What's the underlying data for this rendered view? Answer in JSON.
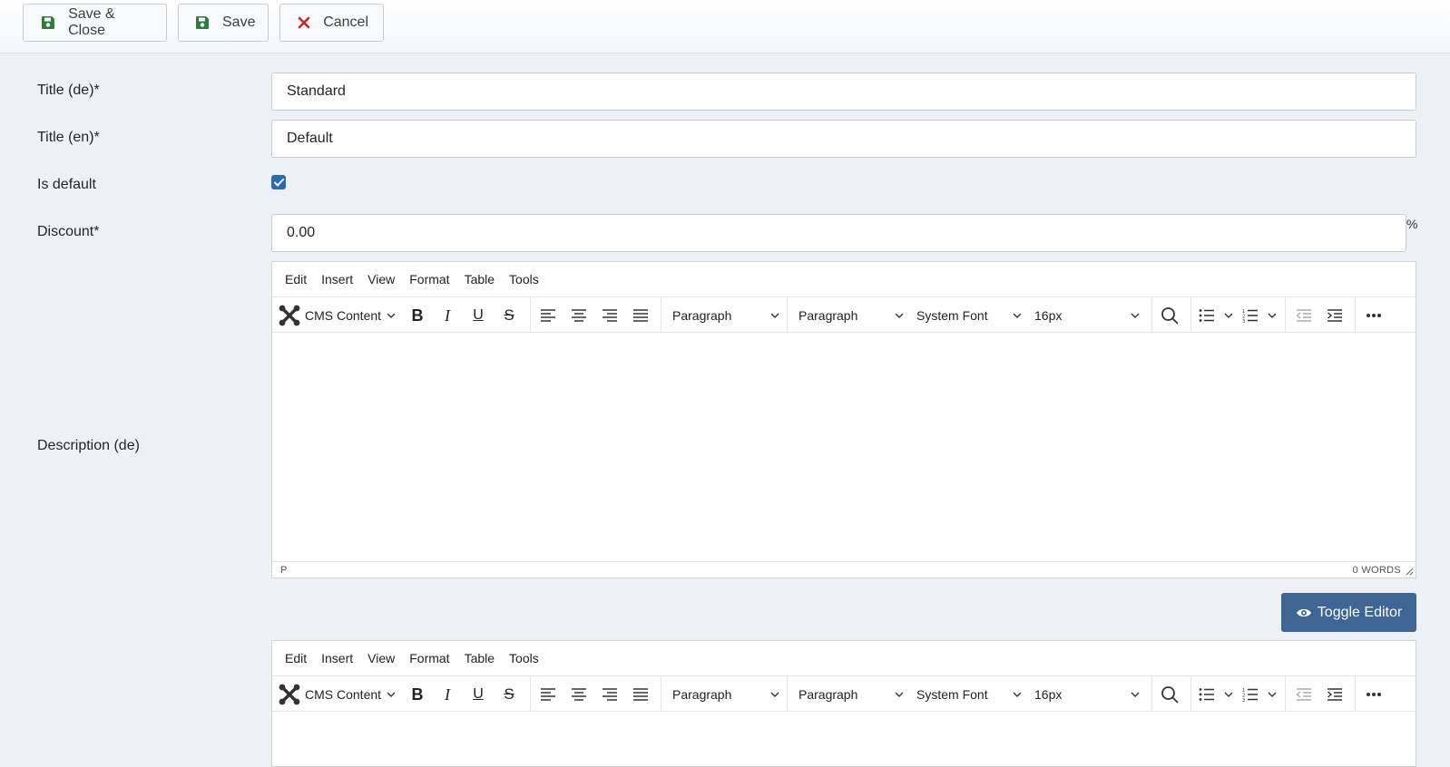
{
  "toolbar": {
    "save_close": "Save & Close",
    "save": "Save",
    "cancel": "Cancel"
  },
  "form": {
    "title_de_label": "Title (de)*",
    "title_de_value": "Standard",
    "title_en_label": "Title (en)*",
    "title_en_value": "Default",
    "is_default_label": "Is default",
    "is_default_checked": true,
    "discount_label": "Discount*",
    "discount_value": "0.00",
    "discount_unit": "%",
    "description_de_label": "Description (de)"
  },
  "editor": {
    "menu": [
      "Edit",
      "Insert",
      "View",
      "Format",
      "Table",
      "Tools"
    ],
    "cms_content": "CMS Content",
    "block_format": "Paragraph",
    "block_format2": "Paragraph",
    "font_family": "System Font",
    "font_size": "16px",
    "status_path": "P",
    "word_count": "0 WORDS"
  },
  "toggle_editor": "Toggle Editor",
  "colors": {
    "accent": "#3e6594",
    "checkbox": "#2a69b8",
    "save_icon": "#2f7d3b",
    "cancel_icon": "#c52827",
    "background": "#edf1f6"
  },
  "icons": {
    "save_close": "floppy-disk-icon",
    "save": "floppy-disk-icon",
    "cancel": "close-x-icon",
    "toggle_editor": "eye-icon"
  }
}
